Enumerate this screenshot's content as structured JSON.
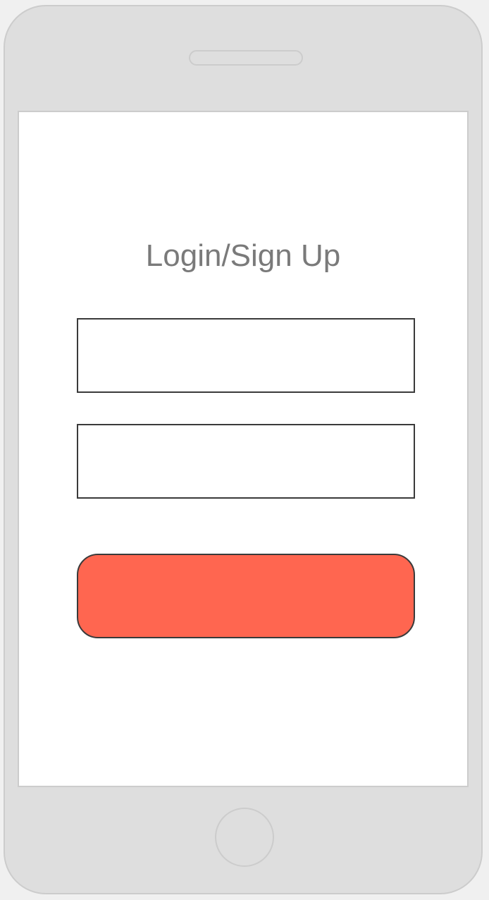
{
  "login": {
    "title": "Login/Sign Up",
    "username_value": "",
    "password_value": "",
    "submit_label": ""
  },
  "colors": {
    "device_body": "#dedede",
    "device_outline": "#cccccc",
    "screen": "#ffffff",
    "title_text": "#7a7a7a",
    "field_border": "#3a3a3a",
    "submit_button": "#ff6650"
  }
}
